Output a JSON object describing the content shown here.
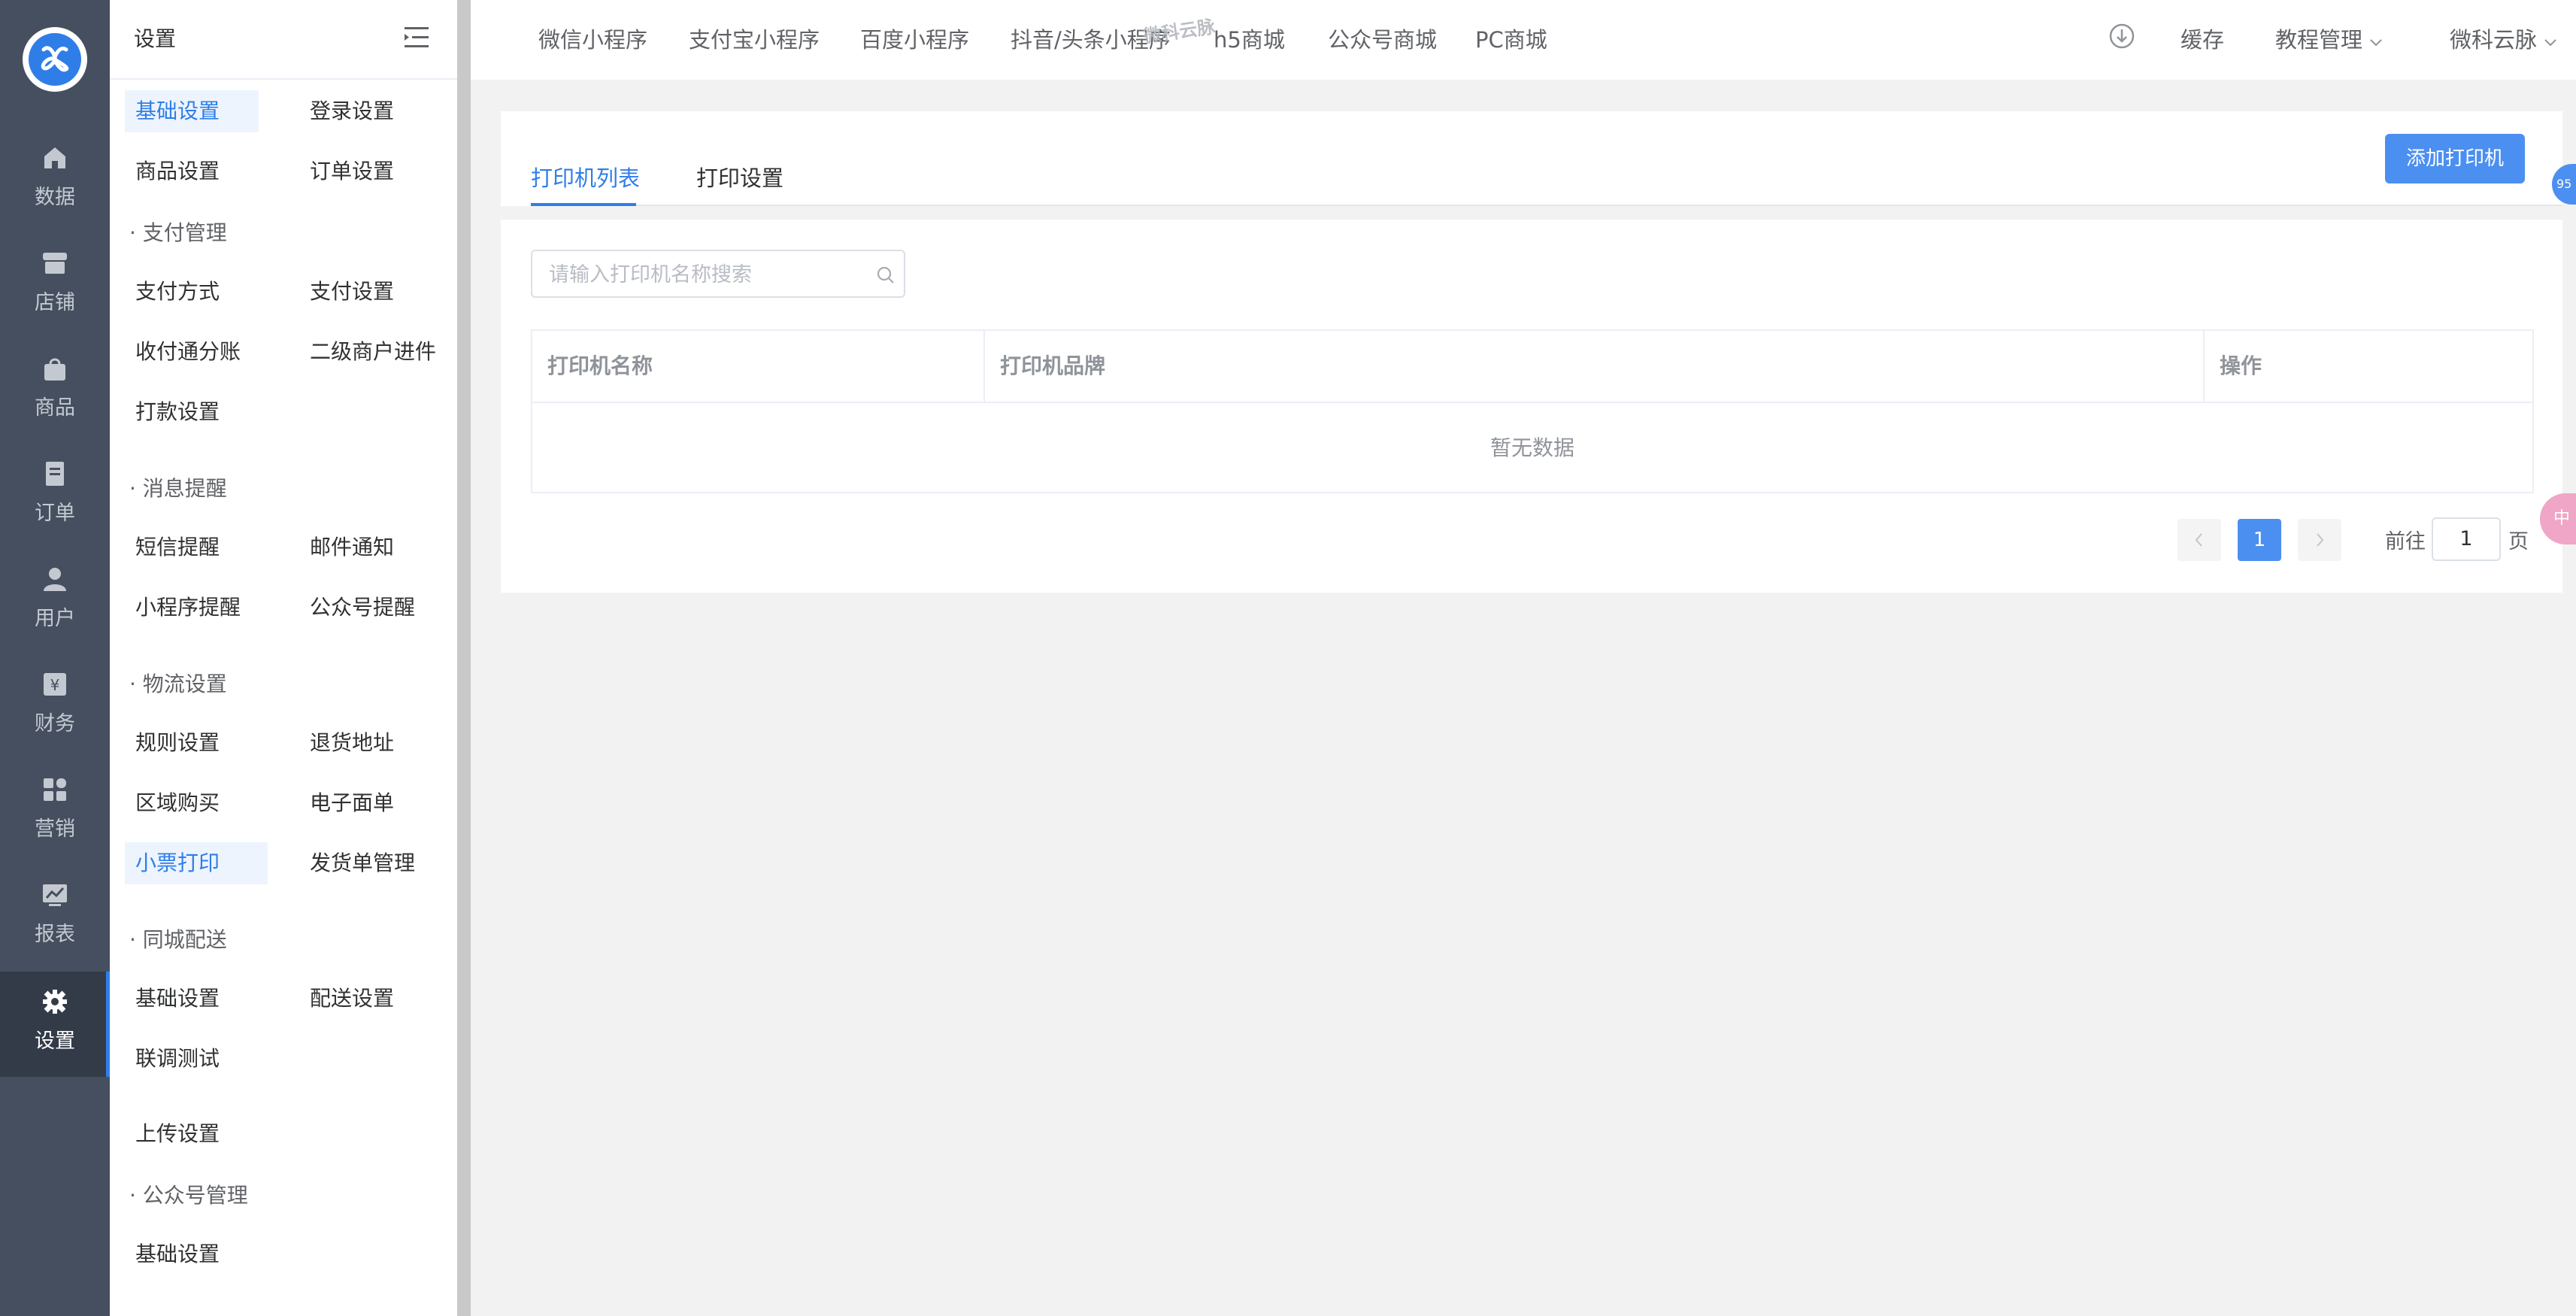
{
  "rail": {
    "items": [
      {
        "label": "数据",
        "icon": "home-icon"
      },
      {
        "label": "店铺",
        "icon": "store-icon"
      },
      {
        "label": "商品",
        "icon": "bag-icon"
      },
      {
        "label": "订单",
        "icon": "order-icon"
      },
      {
        "label": "用户",
        "icon": "user-icon"
      },
      {
        "label": "财务",
        "icon": "finance-icon"
      },
      {
        "label": "营销",
        "icon": "grid-icon"
      },
      {
        "label": "报表",
        "icon": "chart-icon"
      },
      {
        "label": "设置",
        "icon": "gear-icon",
        "active": true
      }
    ]
  },
  "submenu": {
    "title": "设置",
    "items": {
      "basic": "基础设置",
      "login": "登录设置",
      "goods": "商品设置",
      "order": "订单设置",
      "pay_group": "· 支付管理",
      "pay_method": "支付方式",
      "pay_setting": "支付设置",
      "split": "收付通分账",
      "sub_merchant": "二级商户进件",
      "payout": "打款设置",
      "msg_group": "· 消息提醒",
      "sms": "短信提醒",
      "mail": "邮件通知",
      "mini_msg": "小程序提醒",
      "mp_msg": "公众号提醒",
      "logistics_group": "· 物流设置",
      "rules": "规则设置",
      "return_addr": "退货地址",
      "region": "区域购买",
      "eorder": "电子面单",
      "ticket_print": "小票打印",
      "ship_bill": "发货单管理",
      "city_group": "· 同城配送",
      "city_basic": "基础设置",
      "city_delivery": "配送设置",
      "city_test": "联调测试",
      "upload": "上传设置",
      "mp_group": "· 公众号管理",
      "mp_basic": "基础设置"
    }
  },
  "topbar": {
    "tabs": [
      "微信小程序",
      "支付宝小程序",
      "百度小程序",
      "抖音/头条小程序",
      "h5商城",
      "公众号商城",
      "PC商城"
    ],
    "watermark": "微科云脉",
    "cache": "缓存",
    "tutorial": "教程管理",
    "account": "微科云脉"
  },
  "card": {
    "tabs": [
      "打印机列表",
      "打印设置"
    ],
    "add_button": "添加打印机",
    "search_placeholder": "请输入打印机名称搜索",
    "columns": [
      "打印机名称",
      "打印机品牌",
      "操作"
    ],
    "empty": "暂无数据",
    "pagination": {
      "current": "1",
      "goto_label": "前往",
      "goto_value": "1",
      "page_suffix": "页"
    }
  },
  "floaters": {
    "badge": "95",
    "pink": "中"
  },
  "colors": {
    "accent": "#2f7ee8",
    "rail_bg": "#454f5f",
    "rail_active": "#333b48"
  }
}
